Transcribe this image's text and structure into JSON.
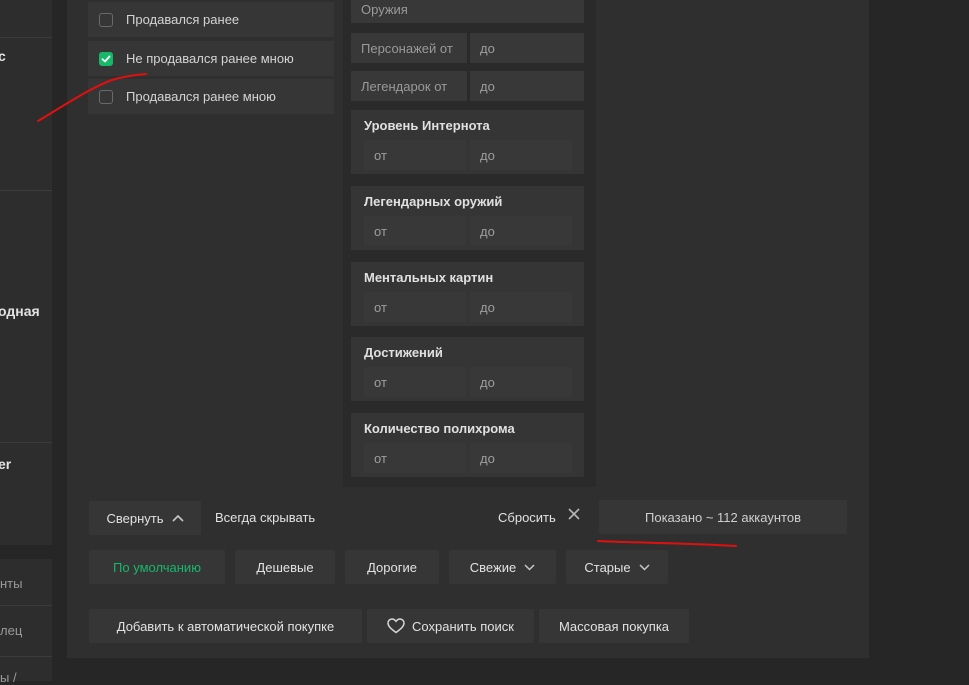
{
  "sidebar": {
    "fragment_1": "c",
    "fragment_2": "одная",
    "fragment_3": "er",
    "fragment_4": "нты",
    "fragment_5": "лец",
    "fragment_6": "ы /"
  },
  "checklist": {
    "items": [
      {
        "label": "Продавался ранее",
        "checked": false
      },
      {
        "label": "Не продавался ранее мною",
        "checked": true
      },
      {
        "label": "Продавался ранее мною",
        "checked": false
      }
    ]
  },
  "filters": {
    "weapons_label": "Оружия",
    "characters_from": "Персонажей от",
    "characters_to": "до",
    "legendaries_from": "Легендарок от",
    "legendaries_to": "до",
    "groups": [
      {
        "title": "Уровень Интернота",
        "from": "от",
        "to": "до"
      },
      {
        "title": "Легендарных оружий",
        "from": "от",
        "to": "до"
      },
      {
        "title": "Ментальных картин",
        "from": "от",
        "to": "до"
      },
      {
        "title": "Достижений",
        "from": "от",
        "to": "до"
      },
      {
        "title": "Количество полихрома",
        "from": "от",
        "to": "до"
      }
    ]
  },
  "controls": {
    "collapse_label": "Свернуть",
    "always_hide_label": "Всегда скрывать",
    "reset_label": "Сбросить",
    "results_label": "Показано ~ 112 аккаунтов"
  },
  "sort": {
    "default": "По умолчанию",
    "cheap": "Дешевые",
    "expensive": "Дорогие",
    "fresh": "Свежие",
    "old": "Старые"
  },
  "actions": {
    "auto_buy": "Добавить к автоматической покупке",
    "save_search": "Сохранить поиск",
    "bulk_buy": "Массовая покупка"
  },
  "colors": {
    "accent_green": "#17b86a",
    "annotation_red": "#e01010"
  }
}
